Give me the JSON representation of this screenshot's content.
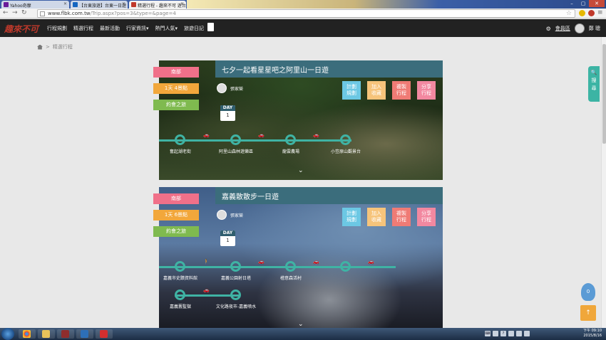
{
  "browser": {
    "tabs": [
      {
        "label": "Yahoo奇摩",
        "favicon_color": "#6a1b9a",
        "active": false
      },
      {
        "label": "【台東旅遊】台東一日遊",
        "favicon_color": "#1565c0",
        "active": false
      },
      {
        "label": "精選行程 - 趣來不可 遊台",
        "favicon_color": "#c0392b",
        "active": true
      }
    ],
    "url_host": "www.flbk.com.tw",
    "url_path": "/Trip.aspx?pos=3&type=&page=4"
  },
  "site": {
    "logo": "趣來不可",
    "nav": [
      "行程規劃",
      "精選行程",
      "最新活動",
      "行家資訊▾",
      "熱門人氣▾",
      "旅遊日記"
    ],
    "user_label": "會員區",
    "user_name": "鄭 聰"
  },
  "breadcrumb": {
    "current": "精選行程"
  },
  "trips": [
    {
      "title": "七夕一起看星星吧之阿里山一日遊",
      "tags": [
        "南部",
        "1天 4景點",
        "約會之旅"
      ],
      "author": "張家榮",
      "actions": [
        "計劃\n規劃",
        "加入\n收藏",
        "複製\n行程",
        "分享\n行程"
      ],
      "day_label": "DAY",
      "day_num": "1",
      "stops": [
        "奮起湖老街",
        "阿里山森林遊樂區",
        "龍雲農場",
        "小笠原山觀景台"
      ],
      "chevron": "⌄"
    },
    {
      "title": "嘉義散散步一日遊",
      "tags": [
        "南部",
        "1天 6景點",
        "約會之旅"
      ],
      "author": "張家榮",
      "actions": [
        "計劃\n規劃",
        "加入\n收藏",
        "複製\n行程",
        "分享\n行程"
      ],
      "day_label": "DAY",
      "day_num": "1",
      "stops_row1": [
        "嘉義市史蹟資料館",
        "嘉義公園射日塔",
        "檜意森活村"
      ],
      "stops_row2": [
        "嘉義舊監獄",
        "文化路夜市-嘉義噴水"
      ],
      "chevron": "⌄"
    }
  ],
  "floating": {
    "search": "搜\n尋",
    "bubble_count": "0",
    "totop": "↑"
  },
  "taskbar": {
    "time": "下午 09:10",
    "date": "2015/8/16"
  },
  "colors": {
    "teal": "#3b6d7c",
    "route": "#3fb3a4",
    "pink": "#f07089",
    "orange": "#f2a73b",
    "green": "#7fba4f"
  }
}
